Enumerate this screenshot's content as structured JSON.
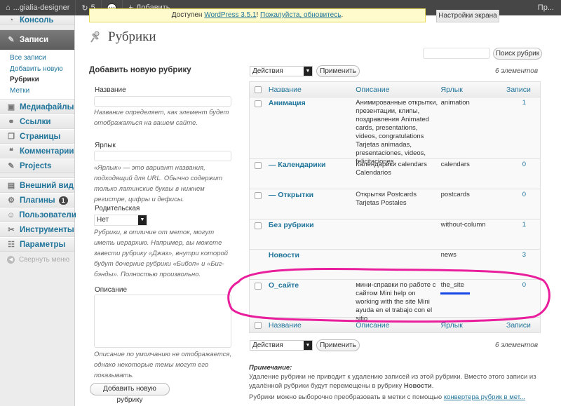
{
  "adminbar": {
    "site_name": "...gialia-designer",
    "updates_count": "5",
    "new_label": "Добавить",
    "right_text": "Пр..."
  },
  "sidebar": {
    "console_label": "Консоль",
    "posts_label": "Записи",
    "posts_sub": [
      "Все записи",
      "Добавить новую",
      "Рубрики",
      "Метки"
    ],
    "media_label": "Медиафайлы",
    "links_label": "Ссылки",
    "pages_label": "Страницы",
    "comments_label": "Комментарии",
    "projects_label": "Projects",
    "appearance_label": "Внешний вид",
    "plugins_label": "Плагины",
    "plugins_badge": "1",
    "users_label": "Пользователи",
    "tools_label": "Инструменты",
    "settings_label": "Параметры",
    "collapse_label": "Свернуть меню"
  },
  "notice": {
    "prefix": "Доступен ",
    "link_wp": "WordPress 3.5.1",
    "sep": "! ",
    "link_update": "Пожалуйста, обновитесь",
    "suffix": "."
  },
  "screen_options": "Настройки экрана",
  "page_title": "Рубрики",
  "search": {
    "button": "Поиск рубрик"
  },
  "form": {
    "title": "Добавить новую рубрику",
    "name_label": "Название",
    "name_desc": "Название определяет, как элемент будет отображаться на вашем сайте.",
    "slug_label": "Ярлык",
    "slug_desc": "«Ярлык» — это вариант названия, подходящий для URL. Обычно содержит только латинские буквы в нижнем регистре, цифры и дефисы.",
    "parent_label": "Родительская",
    "parent_value": "Нет",
    "parent_desc": "Рубрики, в отличие от меток, могут иметь иерархию. Например, вы можете завести рубрику «Джаз», внутри которой будут дочерние рубрики «Бибоп» и «Биг-бэнды». Полностью произвольно.",
    "desc_label": "Описание",
    "desc_desc": "Описание по умолчанию не отображается, однако некоторые темы могут его показывать.",
    "submit": "Добавить новую рубрику"
  },
  "bulk": {
    "action_value": "Действия",
    "apply": "Применить",
    "count": "6 элементов"
  },
  "table": {
    "headers": {
      "name": "Название",
      "desc": "Описание",
      "slug": "Ярлык",
      "count": "Записи"
    },
    "rows": [
      {
        "name": "Анимация",
        "desc": "Анимированные открытки, презентации, клипы, поздравления Animated cards, presentations, videos, congratulations Tarjetas animadas, presentaciones, videos, felicitaciones",
        "slug": "animation",
        "count": "1",
        "checkbox": true
      },
      {
        "name": "— Календарики",
        "desc": "Календарики calendars Calendarios",
        "slug": "calendars",
        "count": "0",
        "checkbox": true
      },
      {
        "name": "— Открытки",
        "desc": "Открытки Postcards Tarjetas Postales",
        "slug": "postcards",
        "count": "0",
        "checkbox": true
      },
      {
        "name": "Без рубрики",
        "desc": "",
        "slug": "without-column",
        "count": "1",
        "checkbox": true
      },
      {
        "name": "Новости",
        "desc": "",
        "slug": "news",
        "count": "3",
        "checkbox": false
      },
      {
        "name": "О_сайте",
        "desc": "мини-справки по работе с сайтом Mini help on working with the site Mini ayuda en el trabajo con el sitio",
        "slug": "the_site",
        "count": "0",
        "checkbox": true
      }
    ]
  },
  "note": {
    "title": "Примечание:",
    "line1_a": "Удаление рубрики не приводит к удалению записей из этой рубрики. Вместо этого записи из удалённой рубрики будут перемещены в рубрику ",
    "line1_b": "Новости",
    "line1_c": ".",
    "line2_a": "Рубрики можно выборочно преобразовать в метки с помощью ",
    "line2_link": "конвертера рубрик в мет..."
  },
  "colors": {
    "link": "#21759b",
    "highlight_ellipse": "#e91e9c",
    "slug_underline": "#1447e6"
  }
}
